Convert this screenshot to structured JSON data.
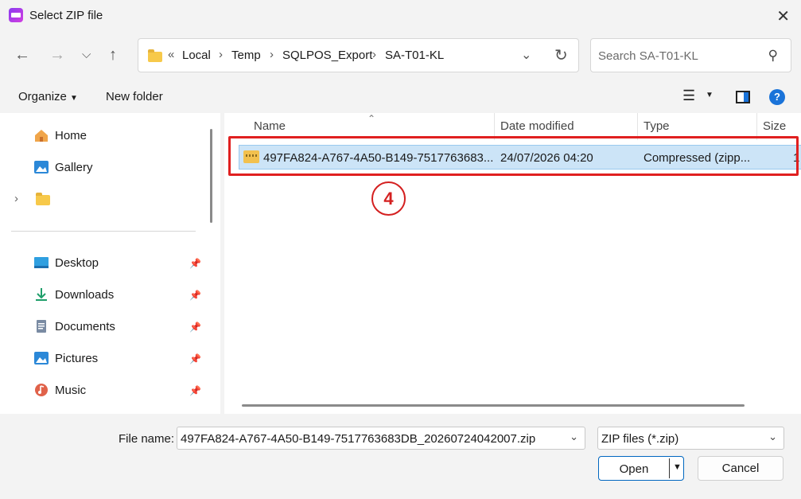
{
  "window": {
    "title": "Select ZIP file"
  },
  "breadcrumb": {
    "overflow": "«",
    "items": [
      "Local",
      "Temp",
      "SQLPOS_Export",
      "SA-T01-KL"
    ]
  },
  "search": {
    "placeholder": "Search SA-T01-KL"
  },
  "toolbar": {
    "organize_label": "Organize",
    "new_folder_label": "New folder"
  },
  "sidebar": {
    "items": [
      {
        "label": "Home",
        "icon": "home-icon"
      },
      {
        "label": "Gallery",
        "icon": "gallery-icon"
      },
      {
        "label": "",
        "icon": "folder-icon"
      }
    ],
    "pinned": [
      {
        "label": "Desktop",
        "icon": "desktop-icon"
      },
      {
        "label": "Downloads",
        "icon": "downloads-icon"
      },
      {
        "label": "Documents",
        "icon": "documents-icon"
      },
      {
        "label": "Pictures",
        "icon": "pictures-icon"
      },
      {
        "label": "Music",
        "icon": "music-icon"
      }
    ]
  },
  "file_list": {
    "columns": [
      "Name",
      "Date modified",
      "Type",
      "Size"
    ],
    "rows": [
      {
        "name": "497FA824-A767-4A50-B149-7517763683...",
        "date": "24/07/2026 04:20",
        "type": "Compressed (zipp...",
        "size": "1"
      }
    ]
  },
  "annotation": {
    "step": "4",
    "color": "#e02020"
  },
  "footer": {
    "file_name_label": "File name:",
    "file_name_value": "497FA824-A767-4A50-B149-7517763683DB_20260724042007.zip",
    "file_type": "ZIP files (*.zip)",
    "open_label": "Open",
    "cancel_label": "Cancel"
  },
  "colors": {
    "accent": "#0067c0",
    "selection": "#cce4f7"
  }
}
